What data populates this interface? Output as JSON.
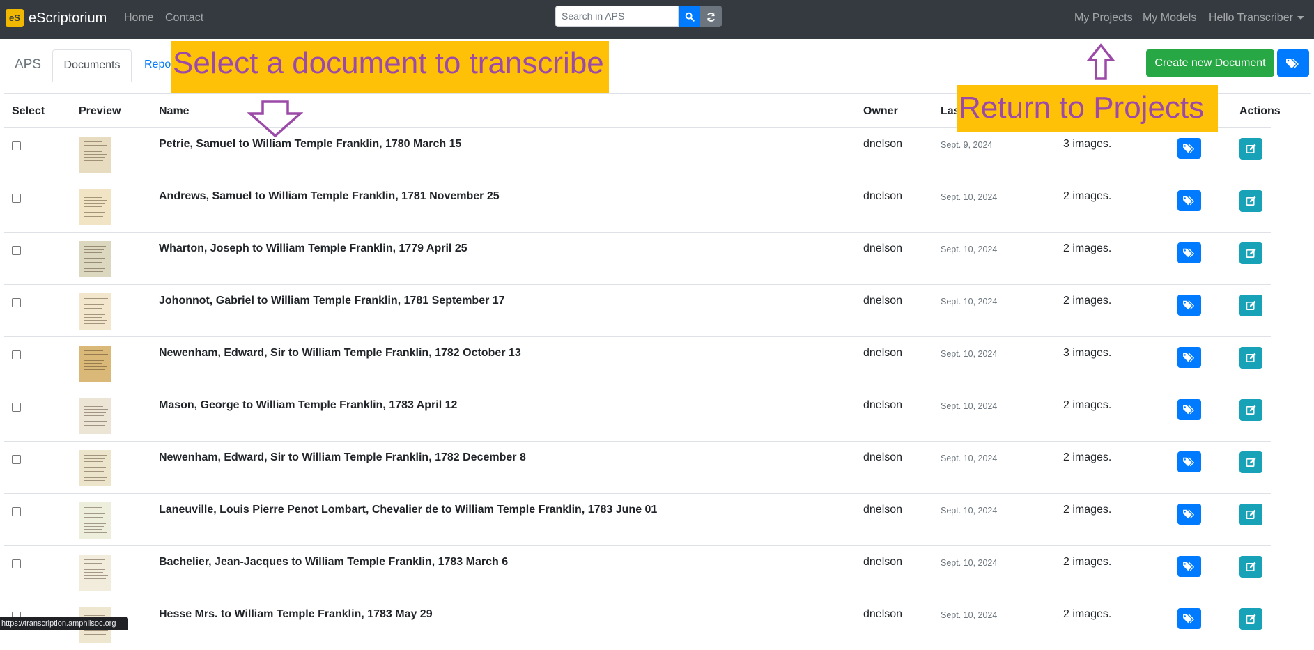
{
  "nav": {
    "brand": "eScriptorium",
    "brand_logo": "eS",
    "home": "Home",
    "contact": "Contact",
    "search_placeholder": "Search in APS",
    "my_projects": "My Projects",
    "my_models": "My Models",
    "user": "Hello Transcriber"
  },
  "project": {
    "name": "APS",
    "tabs": [
      "Documents",
      "Repor"
    ],
    "create_button": "Create new Document"
  },
  "table": {
    "headers": [
      "Select",
      "Preview",
      "Name",
      "Owner",
      "Las",
      "",
      "",
      "Actions"
    ],
    "rows": [
      {
        "name": "Petrie, Samuel to William Temple Franklin, 1780 March 15",
        "owner": "dnelson",
        "date": "Sept. 9, 2024",
        "images": "3 images."
      },
      {
        "name": "Andrews, Samuel to William Temple Franklin, 1781 November 25",
        "owner": "dnelson",
        "date": "Sept. 10, 2024",
        "images": "2 images."
      },
      {
        "name": "Wharton, Joseph to William Temple Franklin, 1779 April 25",
        "owner": "dnelson",
        "date": "Sept. 10, 2024",
        "images": "2 images."
      },
      {
        "name": "Johonnot, Gabriel to William Temple Franklin, 1781 September 17",
        "owner": "dnelson",
        "date": "Sept. 10, 2024",
        "images": "2 images."
      },
      {
        "name": "Newenham, Edward, Sir to William Temple Franklin, 1782 October 13",
        "owner": "dnelson",
        "date": "Sept. 10, 2024",
        "images": "3 images."
      },
      {
        "name": "Mason, George to William Temple Franklin, 1783 April 12",
        "owner": "dnelson",
        "date": "Sept. 10, 2024",
        "images": "2 images."
      },
      {
        "name": "Newenham, Edward, Sir to William Temple Franklin, 1782 December 8",
        "owner": "dnelson",
        "date": "Sept. 10, 2024",
        "images": "2 images."
      },
      {
        "name": "Laneuville, Louis Pierre Penot Lombart, Chevalier de to William Temple Franklin, 1783 June 01",
        "owner": "dnelson",
        "date": "Sept. 10, 2024",
        "images": "2 images."
      },
      {
        "name": "Bachelier, Jean-Jacques to William Temple Franklin, 1783 March 6",
        "owner": "dnelson",
        "date": "Sept. 10, 2024",
        "images": "2 images."
      },
      {
        "name": "Hesse Mrs. to William Temple Franklin, 1783 May 29",
        "owner": "dnelson",
        "date": "Sept. 10, 2024",
        "images": "2 images."
      }
    ],
    "thumb_colors": [
      "#e8dcc0",
      "#f0e4c4",
      "#dcd8c0",
      "#f2e6cc",
      "#d9b878",
      "#ece4d4",
      "#ede4cc",
      "#eeeedc",
      "#f2ecdc",
      "#efe6d0"
    ]
  },
  "annotations": {
    "select_doc": "Select a document to transcribe",
    "return_projects": "Return to Projects",
    "colors": {
      "background": "#ffc107",
      "text": "#9b4aa8"
    }
  },
  "status_bar": "https://transcription.amphilsoc.org"
}
